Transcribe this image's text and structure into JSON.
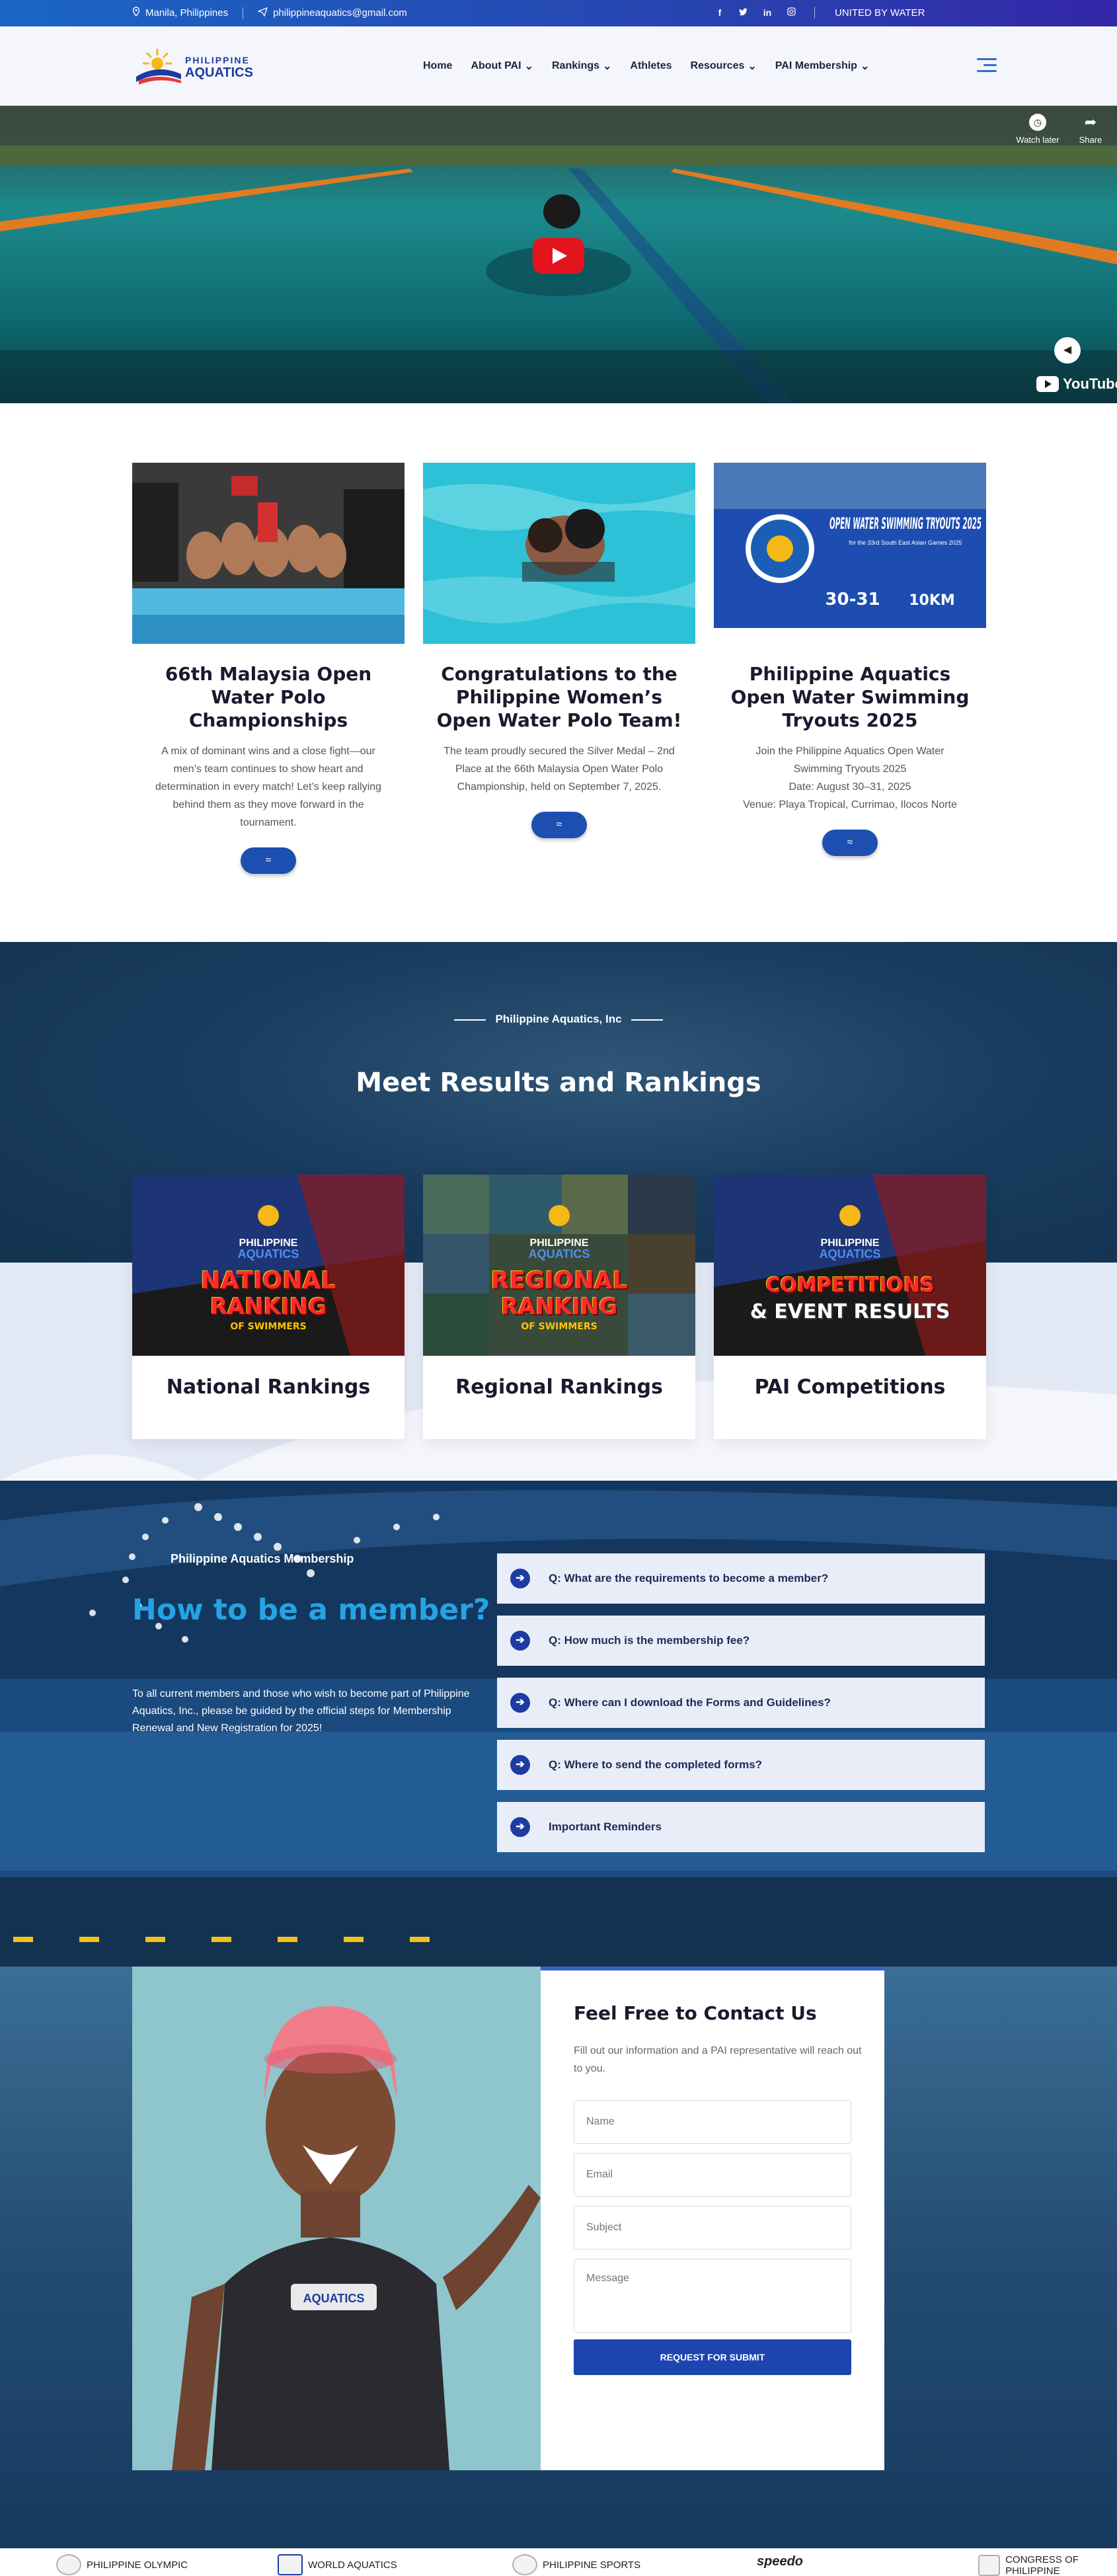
{
  "topbar": {
    "location": "Manila, Philippines",
    "email": "philippineaquatics@gmail.com",
    "social": [
      "f",
      "t",
      "in",
      "ig"
    ],
    "tagline": "UNITED BY WATER"
  },
  "header": {
    "logo_top": "PHILIPPINE",
    "logo_bottom": "AQUATICS",
    "nav": [
      {
        "label": "Home"
      },
      {
        "label": "About PAI",
        "dropdown": true
      },
      {
        "label": "Rankings",
        "dropdown": true
      },
      {
        "label": "Athletes"
      },
      {
        "label": "Resources",
        "dropdown": true
      },
      {
        "label": "PAI Membership",
        "dropdown": true
      }
    ]
  },
  "video": {
    "watch_later": "Watch later",
    "share": "Share",
    "brand": "YouTube"
  },
  "news": [
    {
      "title": "66th Malaysia Open Water Polo Championships",
      "excerpt": "A mix of dominant wins and a close fight—our men’s team continues to show heart and determination in every match!  Let’s keep rallying behind them as they move forward in the tournament."
    },
    {
      "title": "Congratulations to the Philippine Women’s Open Water Polo Team!",
      "excerpt": "The team proudly secured the Silver Medal – 2nd Place at the 66th Malaysia Open Water Polo Championship, held on September 7, 2025."
    },
    {
      "title": "Philippine Aquatics Open Water Swimming Tryouts 2025",
      "excerpt": "Join the Philippine Aquatics Open Water Swimming Tryouts 2025\nDate: August 30–31, 2025\nVenue: Playa Tropical, Currimao, Ilocos Norte",
      "poster_title": "OPEN WATER SWIMMING TRYOUTS 2025",
      "poster_sub": "for the 33rd South East Asian Games 2025",
      "poster_date": "30-31",
      "poster_dist": "10KM"
    }
  ],
  "rankings": {
    "kicker": "Philippine Aquatics, Inc",
    "title": "Meet Results and Rankings",
    "cards": [
      {
        "label": "National Rankings",
        "img_line1": "NATIONAL",
        "img_line2": "RANKING",
        "img_sub": "OF SWIMMERS"
      },
      {
        "label": "Regional Rankings",
        "img_line1": "REGIONAL",
        "img_line2": "RANKING",
        "img_sub": "OF SWIMMERS"
      },
      {
        "label": "PAI Competitions",
        "img_line1": "COMPETITIONS",
        "img_line2": "& EVENT RESULTS",
        "img_sub": ""
      }
    ]
  },
  "membership": {
    "kicker": "Philippine Aquatics Membership",
    "title": "How to be a member?",
    "text": "To all current members and those who wish to become part of Philippine Aquatics, Inc., please be guided by the official steps for Membership Renewal and New Registration for 2025!",
    "faqs": [
      "Q: What are the requirements to become a member?",
      "Q: How much is the membership fee?",
      "Q: Where can I download the Forms and Guidelines?",
      "Q: Where to send the completed forms?",
      "Important Reminders"
    ]
  },
  "contact": {
    "title": "Feel Free to Contact Us",
    "text": "Fill out our information and a PAI representative will reach out to you.",
    "placeholders": {
      "name": "Name",
      "email": "Email",
      "subject": "Subject",
      "message": "Message"
    },
    "submit": "REQUEST FOR SUBMIT",
    "swimsuit_logo": "AQUATICS"
  },
  "partners": [
    {
      "label": "PHILIPPINE OLYMPIC"
    },
    {
      "label": "WORLD AQUATICS"
    },
    {
      "label": "PHILIPPINE SPORTS"
    },
    {
      "label": "speedo"
    },
    {
      "label": "CONGRESS OF PHILIPPINE"
    }
  ],
  "colors": {
    "topbar_start": "#1a66c4",
    "topbar_end": "#3326a8",
    "accent_blue": "#1d45b0",
    "member_title": "#25a3e3",
    "youtube_red": "#e4141f"
  }
}
